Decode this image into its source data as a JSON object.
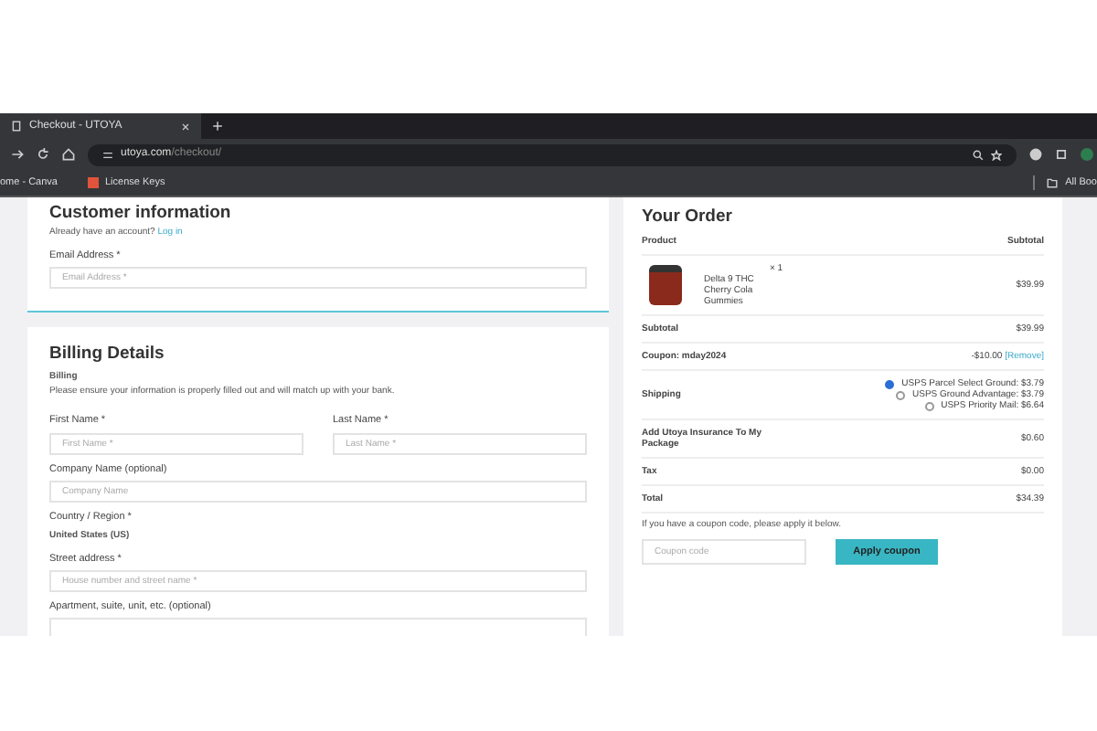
{
  "browser": {
    "tab_title": "Checkout - UTOYA",
    "url_domain": "utoya.com",
    "url_path": "/checkout/",
    "bookmarks": [
      {
        "label": "ome - Canva",
        "kind": "plain"
      },
      {
        "label": "License Keys",
        "kind": "app"
      }
    ],
    "all_bookmarks": "All Boo"
  },
  "customer": {
    "title": "Customer information",
    "login_prompt": "Already have an account?",
    "login_link": "Log in",
    "email_label": "Email Address *",
    "email_placeholder": "Email Address *"
  },
  "billing": {
    "title": "Billing Details",
    "subtitle": "Billing",
    "note": "Please ensure your information is properly filled out and will match up with your bank.",
    "rows": [
      {
        "kind": "pair",
        "fields": [
          {
            "label": "First Name *",
            "placeholder": "First Name *"
          },
          {
            "label": "Last Name *",
            "placeholder": "Last Name *"
          }
        ]
      },
      {
        "kind": "input",
        "label": "Company Name (optional)",
        "placeholder": "Company Name"
      },
      {
        "kind": "static",
        "label": "Country / Region *",
        "value": "United States (US)"
      },
      {
        "kind": "input",
        "label": "Street address *",
        "placeholder": "House number and street name *"
      },
      {
        "kind": "input",
        "label": "Apartment, suite, unit, etc. (optional)"
      }
    ]
  },
  "order": {
    "title": "Your Order",
    "columns": [
      "Product",
      "Subtotal"
    ],
    "item": {
      "name": "Delta 9 THC Cherry Cola Gummies",
      "quantity": "× 1",
      "price": "$39.99"
    },
    "rows": [
      {
        "kind": "plain",
        "label": "Subtotal",
        "value": "$39.99"
      },
      {
        "kind": "coupon",
        "label": "Coupon: mday2024",
        "value": "-$10.00",
        "link": "[Remove]"
      },
      {
        "kind": "shipping",
        "label": "Shipping",
        "options": [
          {
            "label": "USPS Parcel Select Ground: $3.79",
            "selected": true
          },
          {
            "label": "USPS Ground Advantage: $3.79",
            "selected": false
          },
          {
            "label": "USPS Priority Mail: $6.64",
            "selected": false
          }
        ]
      },
      {
        "kind": "plain",
        "label": "Add Utoya Insurance To My Package",
        "value": "$0.60"
      },
      {
        "kind": "plain",
        "label": "Tax",
        "value": "$0.00"
      },
      {
        "kind": "plain",
        "label": "Total",
        "value": "$34.39"
      }
    ],
    "coupon_note": "If you have a coupon code, please apply it below.",
    "coupon_placeholder": "Coupon code",
    "apply_button": "Apply coupon"
  }
}
